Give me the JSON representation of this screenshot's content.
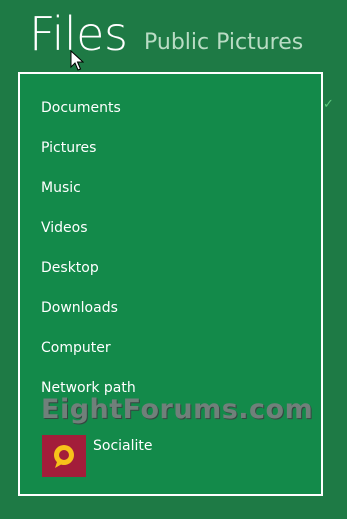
{
  "header": {
    "app_title": "Files",
    "location": "Public Pictures"
  },
  "menu": {
    "items": [
      {
        "label": "Documents",
        "icon": "check-icon"
      },
      {
        "label": "Pictures"
      },
      {
        "label": "Music"
      },
      {
        "label": "Videos"
      },
      {
        "label": "Desktop"
      },
      {
        "label": "Downloads"
      },
      {
        "label": "Computer"
      },
      {
        "label": "Network path"
      }
    ],
    "apps": [
      {
        "label": "Socialite",
        "icon": "socialite-app-icon",
        "tile_color": "#a31d3a"
      }
    ]
  },
  "watermark": "EightForums.com",
  "colors": {
    "background": "#1e7a45",
    "panel": "#138a4a",
    "panel_border": "#ffffff",
    "check": "#5fc97e"
  }
}
